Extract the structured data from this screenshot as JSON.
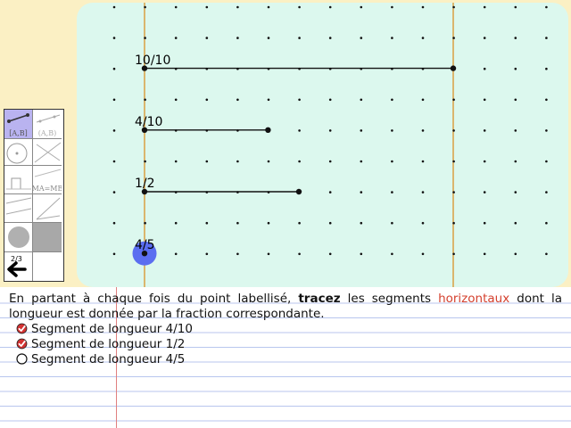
{
  "fractions": [
    {
      "label": "10/10",
      "value": 1.0,
      "drawn": true
    },
    {
      "label": "4/10",
      "value": 0.4,
      "drawn": true
    },
    {
      "label": "1/2",
      "value": 0.5,
      "drawn": true
    },
    {
      "label": "4/5",
      "value": 0.8,
      "drawn": false,
      "highlighted": true
    }
  ],
  "toolbar": {
    "segment_label": "[A,B]",
    "ray_label": "(A,B)",
    "midpoint_label": "MA=MB",
    "page_counter": "2/3"
  },
  "instruction": {
    "part1": "En partant à chaque fois du point labellisé, ",
    "bold": "tracez",
    "part2": " les segments ",
    "red": "horizontaux",
    "part3": " dont la longueur est donnée par la fraction correspondante."
  },
  "tasks": [
    {
      "label": "Segment de longueur 4/10",
      "done": true
    },
    {
      "label": "Segment de longueur 1/2",
      "done": true
    },
    {
      "label": "Segment de longueur 4/5",
      "done": false
    }
  ],
  "colors": {
    "background": "#fbf0c4",
    "canvas": "#dcf8ee",
    "guide_line": "#d9922a",
    "highlight_point": "#5b6ef0",
    "selected_tool": "#b9b3f0",
    "check_red": "#d33333",
    "emphasis_red": "#d4402e"
  }
}
